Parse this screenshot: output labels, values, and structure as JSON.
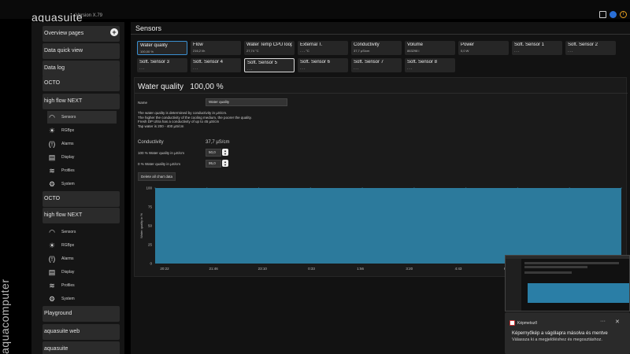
{
  "app": {
    "brand": "aquasuite",
    "version": "Version X.79",
    "vertical_logo": "aquacomputer"
  },
  "sidebar": {
    "items": [
      {
        "label": "Overview pages"
      },
      {
        "label": "Data quick view"
      },
      {
        "label": "Data log"
      },
      {
        "label": "OCTO"
      },
      {
        "label": "high flow NEXT"
      }
    ],
    "submenu1": [
      "Sensors",
      "RGBpx",
      "Alarms",
      "Display",
      "Profiles",
      "System"
    ],
    "items2": [
      {
        "label": "OCTO"
      },
      {
        "label": "high flow NEXT"
      }
    ],
    "submenu2": [
      "Sensors",
      "RGBpx",
      "Alarms",
      "Display",
      "Profiles",
      "System"
    ],
    "items3": [
      {
        "label": "Playground"
      },
      {
        "label": "aquasuite web"
      },
      {
        "label": "aquasuite"
      }
    ]
  },
  "main": {
    "title": "Sensors",
    "tiles": [
      {
        "name": "Water quality",
        "value": "100,00 %"
      },
      {
        "name": "Flow",
        "value": "216,2 l/h"
      },
      {
        "name": "Water Temp CPU loop",
        "value": "27,74 °C"
      },
      {
        "name": "External T.",
        "value": "- - - °C"
      },
      {
        "name": "Conductivity",
        "value": "37,7 µS/cm"
      },
      {
        "name": "Volume",
        "value": "863298 l"
      },
      {
        "name": "Power",
        "value": "0,0 W"
      },
      {
        "name": "Soft. Sensor 1",
        "value": "- - -"
      },
      {
        "name": "Soft. Sensor 2",
        "value": "- - -"
      },
      {
        "name": "Soft. Sensor 3",
        "value": "- - -"
      },
      {
        "name": "Soft. Sensor 4",
        "value": "- - -"
      },
      {
        "name": "Soft. Sensor 5",
        "value": "- - -"
      },
      {
        "name": "Soft. Sensor 6",
        "value": "- - -"
      },
      {
        "name": "Soft. Sensor 7",
        "value": "- - -"
      },
      {
        "name": "Soft. Sensor 8",
        "value": "- - -"
      }
    ]
  },
  "detail": {
    "title": "Water quality",
    "title_value": "100,00 %",
    "name_label": "Name",
    "name_value": "Water quality",
    "desc": [
      "The water quality is determined by conductivity in µS/cm.",
      "The higher the conductivity of the cooling medium, the poorer the quality.",
      "Fresh DP Ultra has a conductivity of up to 45 µS/cm",
      "Tap water is 200 - 400 µS/cm"
    ],
    "conductivity_label": "Conductivity",
    "conductivity_value": "37,7 µS/cm",
    "wq100_label": "100 % Water quality in µS/cm",
    "wq100_value": "50,0",
    "wq0_label": "0 % Water quality in µS/cm",
    "wq0_value": "95,0",
    "delete_button": "Delete all chart data"
  },
  "chart_data": {
    "type": "area",
    "ylabel": "Water quality in %",
    "ylim": [
      0,
      100
    ],
    "yticks": [
      "100",
      "75",
      "50",
      "25",
      "0"
    ],
    "x": [
      "20:22",
      "21:46",
      "23:10",
      "0:33",
      "1:56",
      "3:20",
      "4:43",
      "6:06",
      "7:30",
      "8:52"
    ],
    "values": [
      100,
      100,
      100,
      100,
      100,
      100,
      100,
      100,
      100,
      100
    ],
    "color": "#2c7a9c"
  },
  "notification": {
    "app": "Képmetsző",
    "line1": "Képernyőkép a vágólapra másolva és mentve",
    "line2": "Válassza ki a megjelöléshez és megosztáshoz."
  }
}
